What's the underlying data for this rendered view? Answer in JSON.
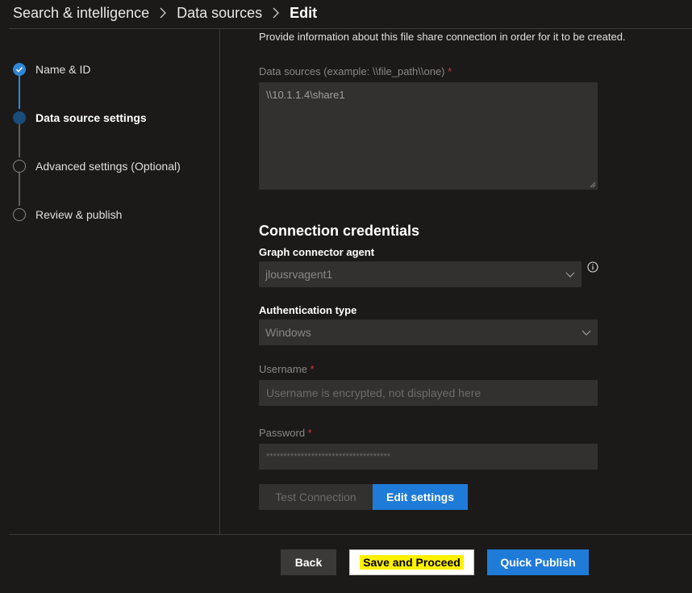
{
  "breadcrumb": {
    "items": [
      "Search & intelligence",
      "Data sources"
    ],
    "current": "Edit"
  },
  "steps": [
    {
      "label": "Name & ID",
      "state": "done"
    },
    {
      "label": "Data source settings",
      "state": "active"
    },
    {
      "label": "Advanced settings (Optional)",
      "state": "todo"
    },
    {
      "label": "Review & publish",
      "state": "todo"
    }
  ],
  "form": {
    "intro": "Provide information about this file share connection in order for it to be created.",
    "data_sources_label": "Data sources (example: \\\\file_path\\\\one)",
    "required_mark": "*",
    "data_sources_value": "\\\\10.1.1.4\\share1",
    "credentials_title": "Connection credentials",
    "agent_label": "Graph connector agent",
    "agent_value": "jlousrvagent1",
    "auth_label": "Authentication type",
    "auth_value": "Windows",
    "username_label": "Username",
    "username_placeholder": "Username is encrypted, not displayed here",
    "password_label": "Password",
    "password_value": "************************************",
    "test_connection": "Test Connection",
    "edit_settings": "Edit settings"
  },
  "footer": {
    "back": "Back",
    "save": "Save and Proceed",
    "quick_publish": "Quick Publish"
  },
  "colors": {
    "accent": "#1f7bd8",
    "highlight": "#fff100",
    "required": "#d13438"
  }
}
